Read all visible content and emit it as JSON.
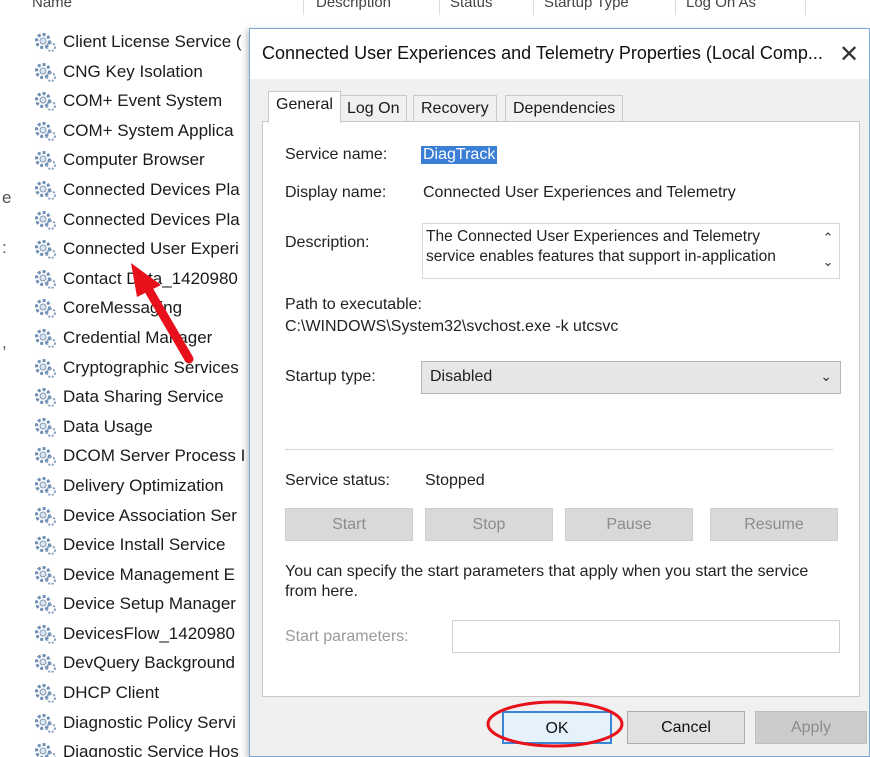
{
  "list_header": {
    "name": "Name",
    "description": "Description",
    "status": "Status",
    "startup_type": "Startup Type",
    "log_on_as": "Log On As"
  },
  "left_stray": [
    "e",
    ":",
    ","
  ],
  "services": [
    "Client License Service (",
    "CNG Key Isolation",
    "COM+ Event System",
    "COM+ System Applica",
    "Computer Browser",
    "Connected Devices Pla",
    "Connected Devices Pla",
    "Connected User Experi",
    "Contact Data_1420980",
    "CoreMessaging",
    "Credential Manager",
    "Cryptographic Services",
    "Data Sharing Service",
    "Data Usage",
    "DCOM Server Process I",
    "Delivery Optimization",
    "Device Association Ser",
    "Device Install Service",
    "Device Management E",
    "Device Setup Manager",
    "DevicesFlow_1420980",
    "DevQuery Background",
    "DHCP Client",
    "Diagnostic Policy Servi",
    "Diagnostic Service Hos"
  ],
  "dialog": {
    "title": "Connected User Experiences and Telemetry Properties (Local Comp...",
    "close_glyph": "✕",
    "tabs": [
      "General",
      "Log On",
      "Recovery",
      "Dependencies"
    ],
    "service_name_label": "Service name:",
    "service_name_value": "DiagTrack",
    "display_name_label": "Display name:",
    "display_name_value": "Connected User Experiences and Telemetry",
    "description_label": "Description:",
    "description_value": "The Connected User Experiences and Telemetry service enables features that support in-application",
    "path_label": "Path to executable:",
    "path_value": "C:\\WINDOWS\\System32\\svchost.exe -k utcsvc",
    "startup_label": "Startup type:",
    "startup_value": "Disabled",
    "status_label": "Service status:",
    "status_value": "Stopped",
    "control_buttons": [
      "Start",
      "Stop",
      "Pause",
      "Resume"
    ],
    "params_hint": "You can specify the start parameters that apply when you start the service from here.",
    "params_label": "Start parameters:",
    "ok_label": "OK",
    "cancel_label": "Cancel",
    "apply_label": "Apply"
  },
  "colors": {
    "selection": "#3a7fd5",
    "annotation_red": "#e8101a",
    "annotation_pink": "#d81b60",
    "dialog_border": "#7aa7d6"
  }
}
